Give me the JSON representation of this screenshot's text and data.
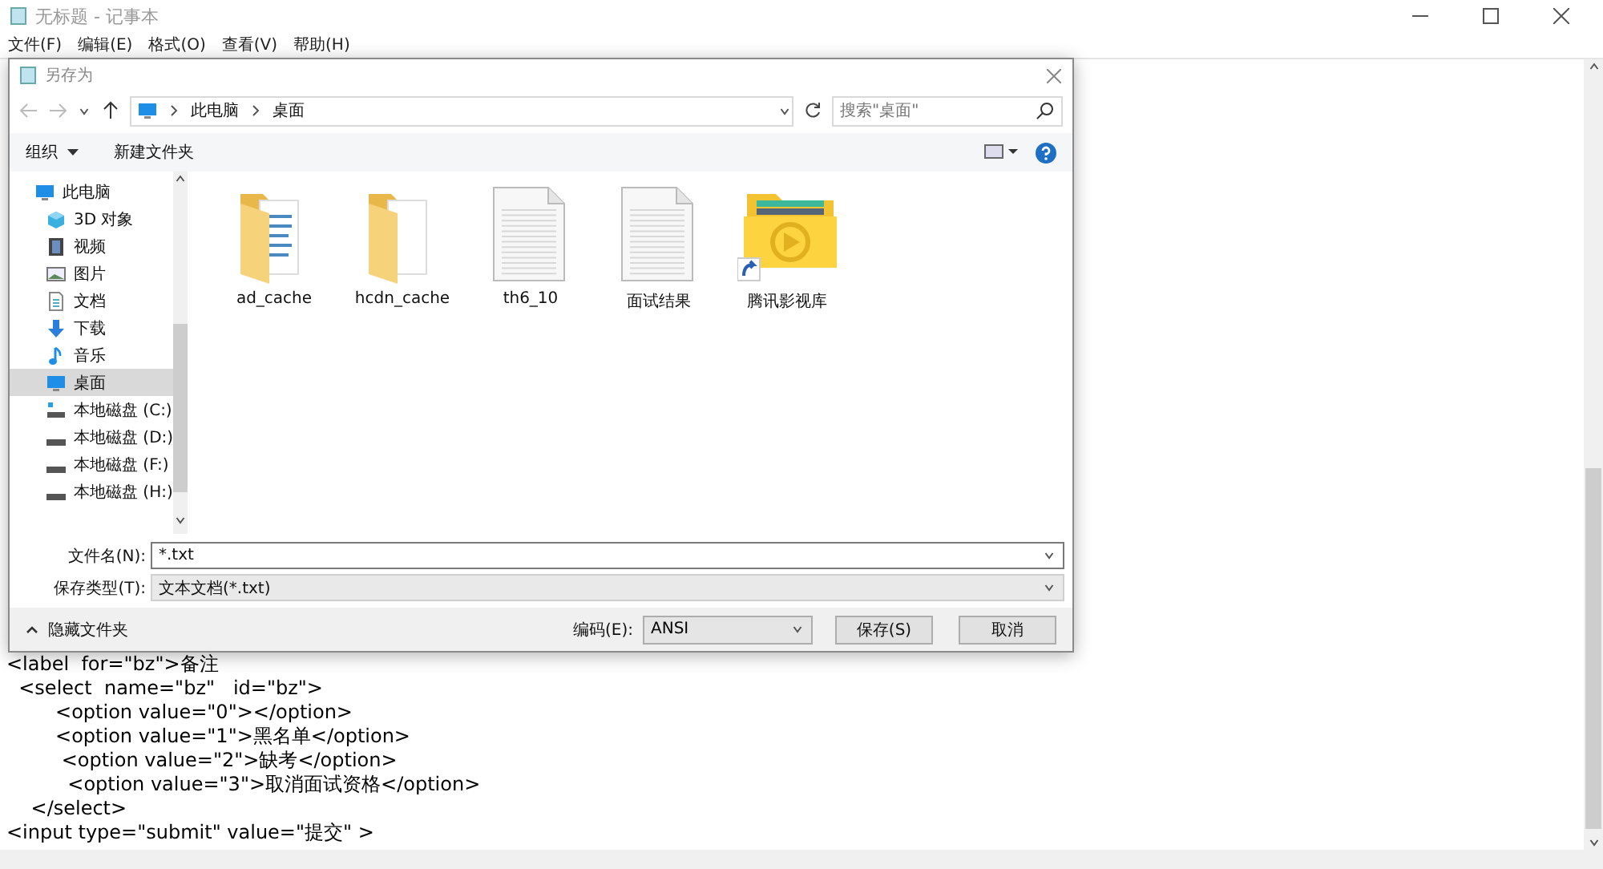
{
  "notepad": {
    "title": "无标题 - 记事本",
    "menu": [
      "文件(F)",
      "编辑(E)",
      "格式(O)",
      "查看(V)",
      "帮助(H)"
    ],
    "lines": [
      "<label  for=\"bz\">备注",
      "  <select  name=\"bz\"   id=\"bz\">",
      "        <option value=\"0\"></option>",
      "        <option value=\"1\">黑名单</option>",
      "         <option value=\"2\">缺考</option>",
      "          <option value=\"3\">取消面试资格</option>",
      "    </select>",
      "<input type=\"submit\" value=\"提交\" >"
    ]
  },
  "dialog": {
    "title": "另存为",
    "breadcrumb": [
      "此电脑",
      "桌面"
    ],
    "search": {
      "placeholder": "搜索\"桌面\""
    },
    "toolbar": {
      "organize": "组织",
      "new_folder": "新建文件夹"
    },
    "sidebar": [
      {
        "label": "此电脑",
        "kind": "pc",
        "selected": false,
        "children": [
          {
            "label": "3D 对象",
            "kind": "cube",
            "selected": false
          },
          {
            "label": "视频",
            "kind": "video",
            "selected": false
          },
          {
            "label": "图片",
            "kind": "picture",
            "selected": false
          },
          {
            "label": "文档",
            "kind": "doc",
            "selected": false
          },
          {
            "label": "下载",
            "kind": "download",
            "selected": false
          },
          {
            "label": "音乐",
            "kind": "music",
            "selected": false
          },
          {
            "label": "桌面",
            "kind": "pc",
            "selected": true
          },
          {
            "label": "本地磁盘 (C:)",
            "kind": "sysdrive",
            "selected": false
          },
          {
            "label": "本地磁盘 (D:)",
            "kind": "drive",
            "selected": false
          },
          {
            "label": "本地磁盘 (F:)",
            "kind": "drive",
            "selected": false
          },
          {
            "label": "本地磁盘 (H:)",
            "kind": "drive",
            "selected": false
          }
        ]
      }
    ],
    "files": [
      {
        "name": "ad_cache",
        "kind": "folder-docs"
      },
      {
        "name": "hcdn_cache",
        "kind": "folder"
      },
      {
        "name": "th6_10",
        "kind": "text"
      },
      {
        "name": "面试结果",
        "kind": "text"
      },
      {
        "name": "腾讯影视库",
        "kind": "app-shortcut"
      }
    ],
    "filename": {
      "label": "文件名(N):",
      "value": "*.txt"
    },
    "filetype": {
      "label": "保存类型(T):",
      "value": "文本文档(*.txt)"
    },
    "hide_folders": "隐藏文件夹",
    "encoding": {
      "label": "编码(E):",
      "value": "ANSI"
    },
    "buttons": [
      "保存(S)",
      "取消"
    ]
  }
}
